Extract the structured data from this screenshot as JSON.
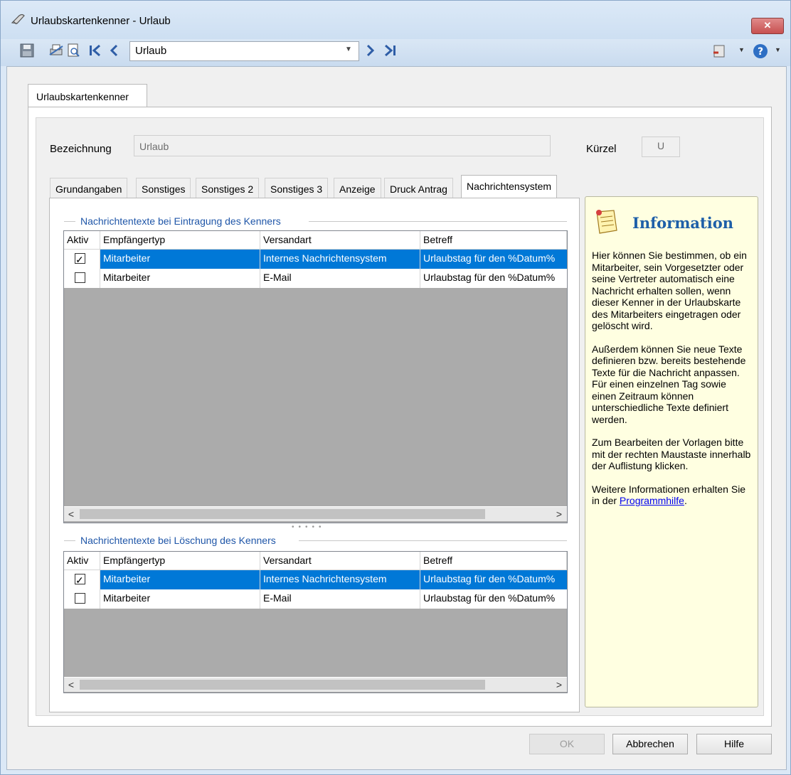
{
  "window": {
    "title": "Urlaubskartenkenner - Urlaub",
    "close_label": "✕"
  },
  "toolbar": {
    "record_combo_value": "Urlaub"
  },
  "outer_tab": {
    "label": "Urlaubskartenkenner"
  },
  "form": {
    "bezeichnung_label": "Bezeichnung",
    "bezeichnung_value": "Urlaub",
    "kuerzel_label": "Kürzel",
    "kuerzel_value": "U"
  },
  "tabs": [
    {
      "label": "Grundangaben"
    },
    {
      "label": "Sonstiges"
    },
    {
      "label": "Sonstiges 2"
    },
    {
      "label": "Sonstiges 3"
    },
    {
      "label": "Anzeige"
    },
    {
      "label": "Druck Antrag"
    },
    {
      "label": "Nachrichtensystem"
    }
  ],
  "grid_eintragung": {
    "title": "Nachrichtentexte bei Eintragung des Kenners",
    "columns": [
      "Aktiv",
      "Empfängertyp",
      "Versandart",
      "Betreff"
    ],
    "rows": [
      {
        "aktiv": true,
        "empfaenger": "Mitarbeiter",
        "versand": "Internes Nachrichtensystem",
        "betreff": "Urlaubstag für den %Datum%"
      },
      {
        "aktiv": false,
        "empfaenger": "Mitarbeiter",
        "versand": "E-Mail",
        "betreff": "Urlaubstag für den %Datum%"
      }
    ]
  },
  "grid_loeschung": {
    "title": "Nachrichtentexte bei Löschung des Kenners",
    "columns": [
      "Aktiv",
      "Empfängertyp",
      "Versandart",
      "Betreff"
    ],
    "rows": [
      {
        "aktiv": true,
        "empfaenger": "Mitarbeiter",
        "versand": "Internes Nachrichtensystem",
        "betreff": "Urlaubstag für den %Datum%"
      },
      {
        "aktiv": false,
        "empfaenger": "Mitarbeiter",
        "versand": "E-Mail",
        "betreff": "Urlaubstag für den %Datum%"
      }
    ]
  },
  "scroll": {
    "left": "<",
    "right": ">"
  },
  "info": {
    "title": "Information",
    "p1": "Hier können Sie bestimmen, ob ein Mitarbeiter, sein Vorgesetzter oder seine Vertreter automatisch eine Nachricht erhalten sollen, wenn dieser Kenner in der Urlaubskarte des Mitarbeiters eingetragen oder gelöscht wird.",
    "p2": "Außerdem können Sie neue Texte definieren bzw. bereits bestehende Texte für die Nachricht anpassen. Für einen einzelnen Tag sowie einen Zeitraum können unterschiedliche Texte definiert werden.",
    "p3": "Zum Bearbeiten der Vorlagen bitte mit der rechten Maustaste innerhalb der Auflistung klicken.",
    "p4_prefix": "Weitere Informationen erhalten Sie in der ",
    "p4_link": "Programmhilfe",
    "p4_suffix": "."
  },
  "buttons": {
    "ok": "OK",
    "cancel": "Abbrechen",
    "help": "Hilfe"
  },
  "colors": {
    "selection": "#0078d7",
    "info_bg": "#ffffe1",
    "link": "#0000ee",
    "info_title": "#1e5fa8",
    "close_button": "#c75050"
  }
}
